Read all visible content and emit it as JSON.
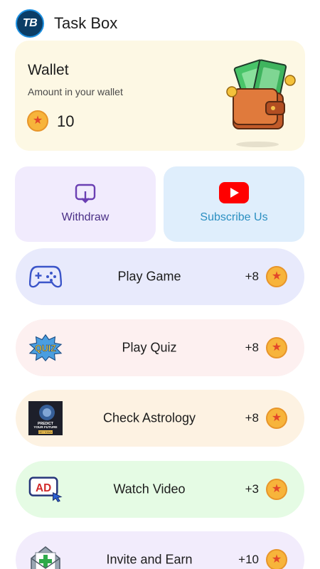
{
  "header": {
    "logo_text": "TB",
    "title": "Task Box"
  },
  "wallet": {
    "title": "Wallet",
    "subtitle": "Amount in your wallet",
    "amount": "10"
  },
  "actions": {
    "withdraw": {
      "label": "Withdraw",
      "icon": "withdraw-icon"
    },
    "subscribe": {
      "label": "Subscribe Us",
      "icon": "youtube-icon"
    }
  },
  "tasks": [
    {
      "label": "Play Game",
      "points": "+8",
      "icon": "gamepad-icon",
      "bg": "#e8eafc"
    },
    {
      "label": "Play Quiz",
      "points": "+8",
      "icon": "quiz-icon",
      "bg": "#fdf0f0"
    },
    {
      "label": "Check Astrology",
      "points": "+8",
      "icon": "astrology-icon",
      "bg": "#fdf2e2"
    },
    {
      "label": "Watch Video",
      "points": "+3",
      "icon": "ad-icon",
      "bg": "#e5fbe4"
    },
    {
      "label": "Invite and Earn",
      "points": "+10",
      "icon": "invite-icon",
      "bg": "#f2ecfc"
    }
  ],
  "astrology_thumb": {
    "line1": "PREDICT",
    "line2": "YOUR FUTURE",
    "cta": "GET TODAY"
  },
  "quiz_badge": "QUIZ",
  "ad_badge": "AD",
  "colors": {
    "coin": "#f7b43b",
    "coin_star": "#e2462a",
    "logo": "#0b3d66",
    "youtube": "#ff0000"
  }
}
